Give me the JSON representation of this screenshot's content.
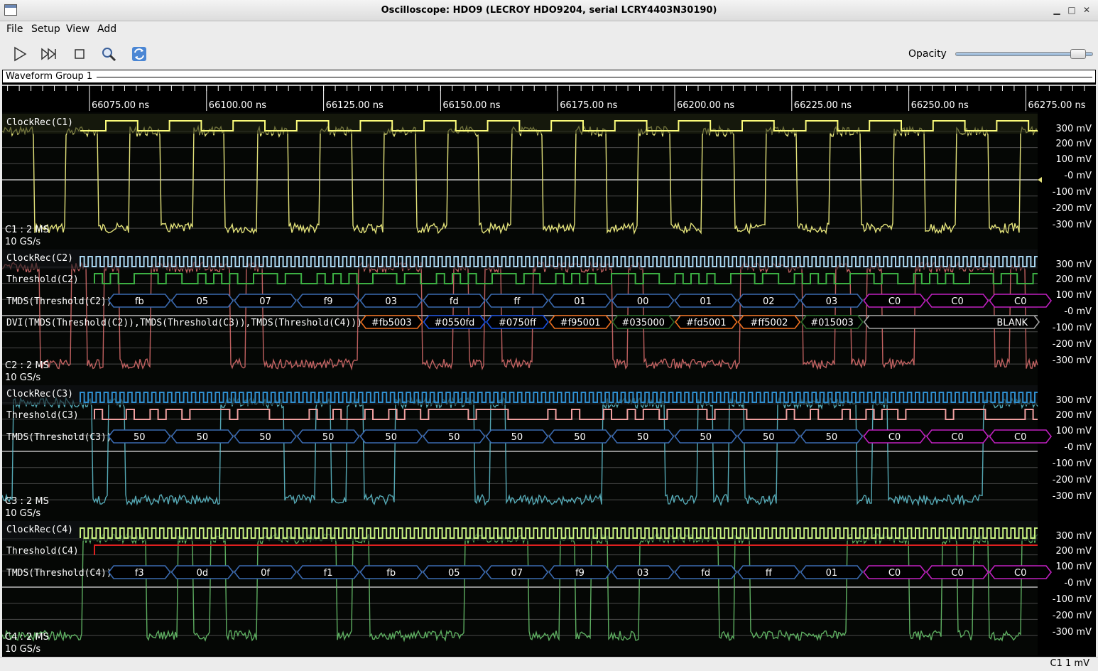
{
  "window": {
    "title": "Oscilloscope: HDO9 (LECROY HDO9204, serial LCRY4403N30190)"
  },
  "menu": [
    "File",
    "Setup",
    "View",
    "Add"
  ],
  "toolbar": {
    "opacity_label": "Opacity",
    "opacity_value": 0.93,
    "buttons": [
      "play-icon",
      "step-icon",
      "stop-icon",
      "zoom-icon",
      "refresh-icon"
    ]
  },
  "group": {
    "title": "Waveform Group 1"
  },
  "timeline": {
    "ticks": [
      "66075.00 ns",
      "66100.00 ns",
      "66125.00 ns",
      "66150.00 ns",
      "66175.00 ns",
      "66200.00 ns",
      "66225.00 ns",
      "66250.00 ns",
      "66275.00 ns"
    ]
  },
  "colors": {
    "c1": "#e3e27a",
    "c2": "#e07070",
    "c3": "#63c4d4",
    "c4": "#6cc970",
    "clk1": "#fbfb7a",
    "clk2": "#a9d6f0",
    "clk3": "#2f8fd0",
    "clk4": "#c8f080",
    "thr2": "#3cb043",
    "thr3": "#f0a0a0",
    "thr4": "#e02020",
    "sym_blue": "#3b6ab0",
    "sym_magenta": "#c020c0",
    "sym_orange": "#f07020",
    "sym_darkgreen": "#2a6a2a",
    "sym_gray": "#a0a0a0",
    "sym_brightblue": "#1a50e0"
  },
  "scale": {
    "labels": [
      "300 mV",
      "200 mV",
      "100 mV",
      "-0 mV",
      "-100 mV",
      "-200 mV",
      "-300 mV"
    ]
  },
  "channels": [
    {
      "id": "C1",
      "trace_label": "ClockRec(C1)",
      "info1": "C1 : 2 MS",
      "info2": "10 GS/s",
      "clock_cycles": 15
    },
    {
      "id": "C2",
      "trace_labels": [
        "ClockRec(C2)",
        "Threshold(C2)",
        "TMDS(Threshold(C2))",
        "DVI(TMDS(Threshold(C2)),TMDS(Threshold(C3)),TMDS(Threshold(C4)))"
      ],
      "info1": "C2 : 2 MS",
      "info2": "10 GS/s",
      "tmds": [
        "fb",
        "05",
        "07",
        "f9",
        "03",
        "fd",
        "ff",
        "01",
        "00",
        "01",
        "02",
        "03",
        "C0",
        "C0",
        "C0"
      ],
      "dvi": [
        "#fb5003",
        "#0550fd",
        "#0750ff",
        "#f95001",
        "#035000",
        "#fd5001",
        "#ff5002",
        "#015003",
        "BLANK"
      ]
    },
    {
      "id": "C3",
      "trace_labels": [
        "ClockRec(C3)",
        "Threshold(C3)",
        "TMDS(Threshold(C3))"
      ],
      "info1": "C3 : 2 MS",
      "info2": "10 GS/s",
      "tmds": [
        "50",
        "50",
        "50",
        "50",
        "50",
        "50",
        "50",
        "50",
        "50",
        "50",
        "50",
        "50",
        "C0",
        "C0",
        "C0"
      ]
    },
    {
      "id": "C4",
      "trace_labels": [
        "ClockRec(C4)",
        "Threshold(C4)",
        "TMDS(Threshold(C4))"
      ],
      "info1": "C4 : 2 MS",
      "info2": "10 GS/s",
      "tmds": [
        "f3",
        "0d",
        "0f",
        "f1",
        "fb",
        "05",
        "07",
        "f9",
        "03",
        "fd",
        "ff",
        "01",
        "C0",
        "C0",
        "C0"
      ]
    }
  ],
  "status": {
    "text": "C1 1 mV"
  }
}
